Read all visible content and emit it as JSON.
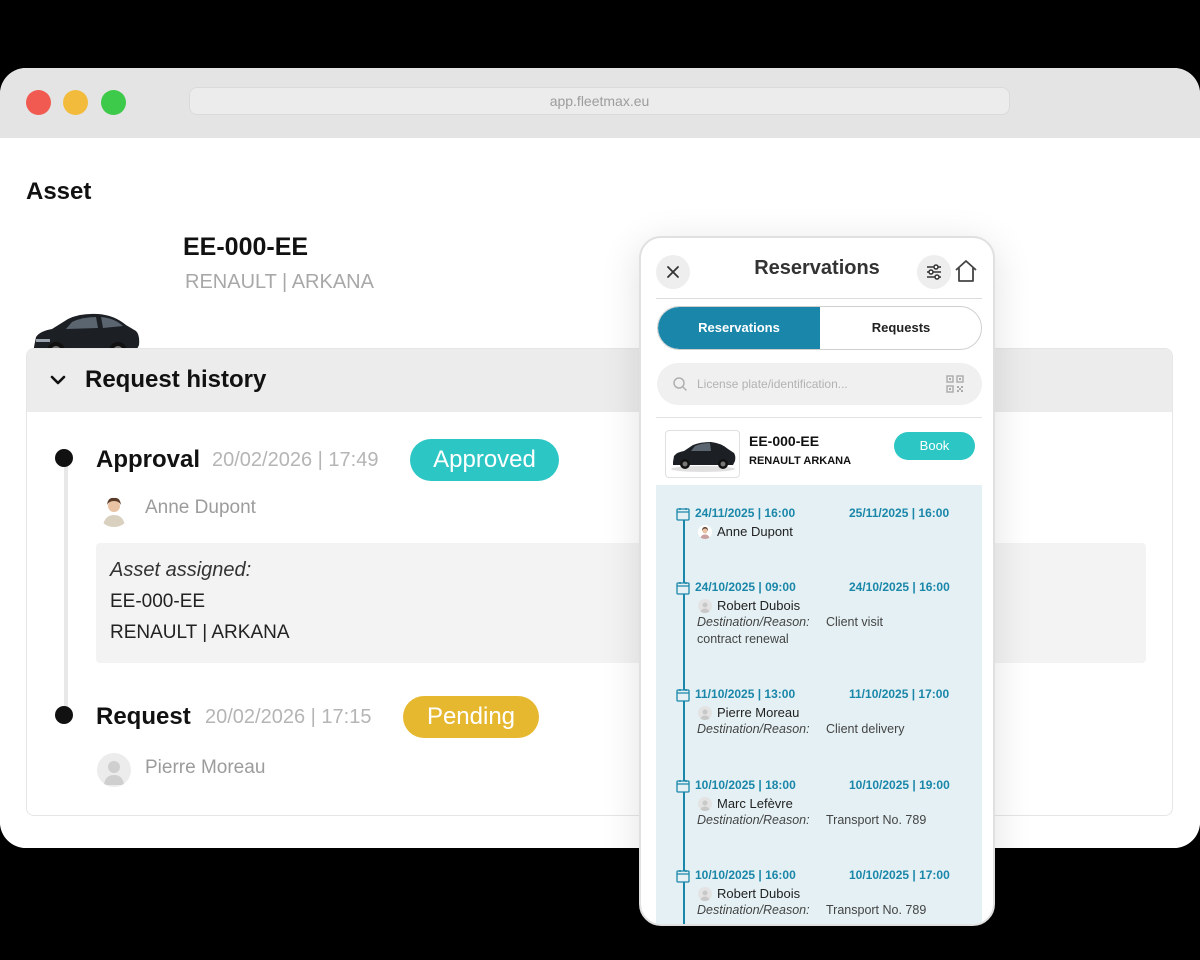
{
  "browser": {
    "url": "app.fleetmax.eu"
  },
  "page": {
    "title": "Asset"
  },
  "asset": {
    "plate": "EE-000-EE",
    "model": "RENAULT | ARKANA"
  },
  "history": {
    "title": "Request history",
    "events": [
      {
        "title": "Approval",
        "date": "20/02/2026 | 17:49",
        "status": "Approved",
        "person": "Anne Dupont",
        "assigned_label": "Asset assigned:",
        "assigned_plate": "EE-000-EE",
        "assigned_model": "RENAULT | ARKANA"
      },
      {
        "title": "Request",
        "date": "20/02/2026 | 17:15",
        "status": "Pending",
        "person": "Pierre Moreau"
      }
    ]
  },
  "phone": {
    "title": "Reservations",
    "close_icon": "close-icon",
    "tabs": [
      "Reservations",
      "Requests"
    ],
    "search_placeholder": "License plate/identification...",
    "car": {
      "plate": "EE-000-EE",
      "model": "RENAULT ARKANA",
      "book_label": "Book"
    },
    "reason_label": "Destination/Reason:",
    "reservations": [
      {
        "start": "24/11/2025 | 16:00",
        "end": "25/11/2025 | 16:00",
        "name": "Anne Dupont",
        "reason": "",
        "reason2": ""
      },
      {
        "start": "24/10/2025 | 09:00",
        "end": "24/10/2025 | 16:00",
        "name": "Robert Dubois",
        "reason": "Client visit",
        "reason2": "contract renewal"
      },
      {
        "start": "11/10/2025 | 13:00",
        "end": "11/10/2025 | 17:00",
        "name": "Pierre Moreau",
        "reason": "Client delivery",
        "reason2": ""
      },
      {
        "start": "10/10/2025 | 18:00",
        "end": "10/10/2025 | 19:00",
        "name": "Marc Lefèvre",
        "reason": "Transport No. 789",
        "reason2": ""
      },
      {
        "start": "10/10/2025 | 16:00",
        "end": "10/10/2025 | 17:00",
        "name": "Robert Dubois",
        "reason": "Transport No. 789",
        "reason2": ""
      }
    ]
  },
  "colors": {
    "primary": "#1a87aa",
    "approved": "#2cc7c5",
    "pending": "#e6b830"
  }
}
